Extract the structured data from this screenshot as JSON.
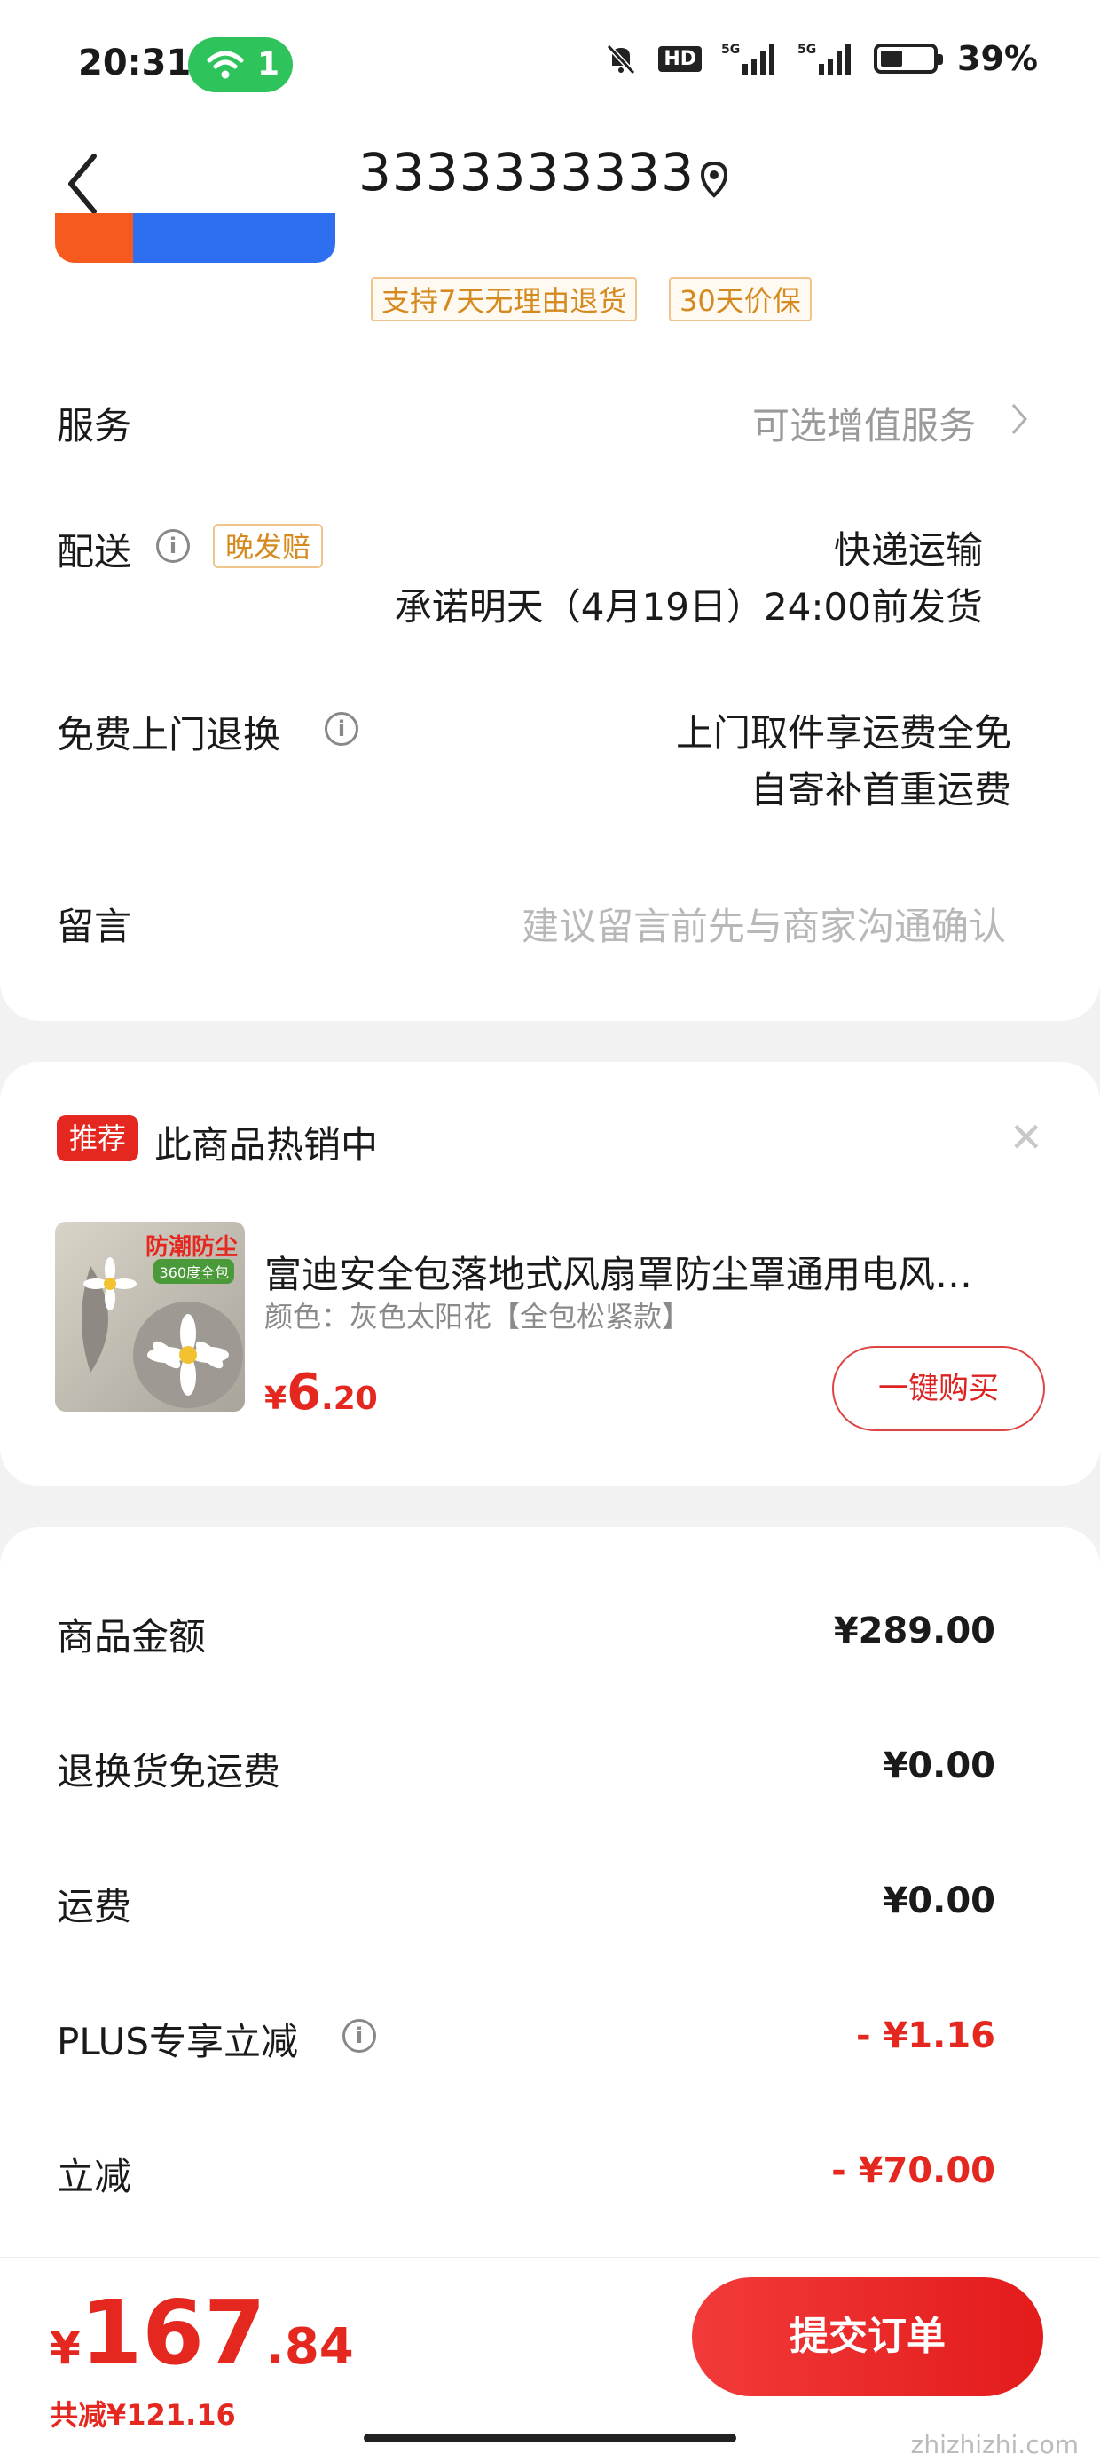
{
  "status_bar": {
    "time": "20:31",
    "wifi_count": "1",
    "hd_label": "HD",
    "battery": "39%"
  },
  "nav": {
    "title": "3333333333"
  },
  "promo_strip": {
    "left": "",
    "right": ""
  },
  "tags": [
    "支持7天无理由退货",
    "30天价保"
  ],
  "service": {
    "label": "服务",
    "value": "可选增值服务"
  },
  "delivery": {
    "label": "配送",
    "badge": "晚发赔",
    "method": "快递运输",
    "promise": "承诺明天（4月19日）24:00前发货"
  },
  "return": {
    "label": "免费上门退换",
    "line1": "上门取件享运费全免",
    "line2": "自寄补首重运费"
  },
  "message": {
    "label": "留言",
    "placeholder": "建议留言前先与商家沟通确认"
  },
  "recommend": {
    "badge": "推荐",
    "title": "此商品热销中",
    "thumb_text": "防潮防尘",
    "thumb_sub": "360度全包",
    "product_name": "富迪安全包落地式风扇罩防尘罩通用电风…",
    "spec": "颜色：灰色太阳花【全包松紧款】",
    "price_currency": "¥",
    "price_int": "6",
    "price_dec": ".20",
    "buy_label": "一键购买"
  },
  "summary": [
    {
      "label": "商品金额",
      "value": "¥289.00",
      "red": false
    },
    {
      "label": "退换货免运费",
      "value": "¥0.00",
      "red": false
    },
    {
      "label": "运费",
      "value": "¥0.00",
      "red": false
    },
    {
      "label": "PLUS专享立减",
      "value": "- ¥1.16",
      "red": true
    },
    {
      "label": "立减",
      "value": "- ¥70.00",
      "red": true
    }
  ],
  "footer": {
    "currency": "¥",
    "total_int": "167",
    "total_dec": ".84",
    "saving": "共减¥121.16",
    "submit_label": "提交订单",
    "watermark": "zhizhizhi.com"
  },
  "colors": {
    "accent": "#e4281f",
    "wifi_pill": "#2fc35c",
    "tag_border": "#f0c48a"
  }
}
